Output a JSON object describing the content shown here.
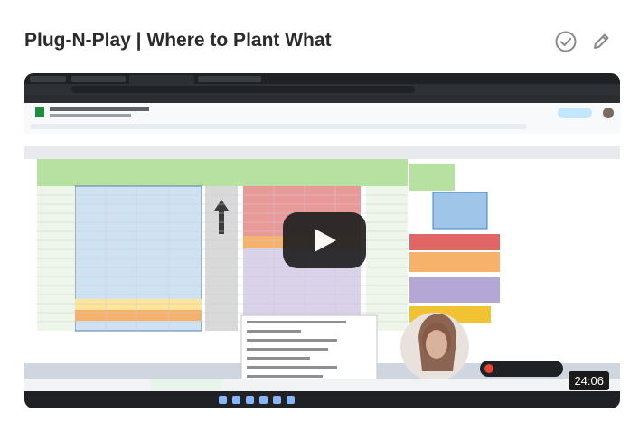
{
  "card": {
    "title": "Plug-N-Play | Where to Plant What",
    "done_icon": "check-circle-icon",
    "edit_icon": "pencil-icon"
  },
  "video": {
    "duration": "24:06",
    "play_icon": "play-icon"
  },
  "colors": {
    "title_text": "#2b2b2b",
    "icon_gray": "#8a8a8a",
    "play_button": "#202020",
    "sheet_green_header": "#b7e1a1",
    "sheet_blue": "#cfe2f3",
    "sheet_red": "#ea9999",
    "sheet_purple": "#d9d2e9",
    "sheet_orange": "#f6b26b",
    "sheet_yellow": "#ffe599"
  }
}
